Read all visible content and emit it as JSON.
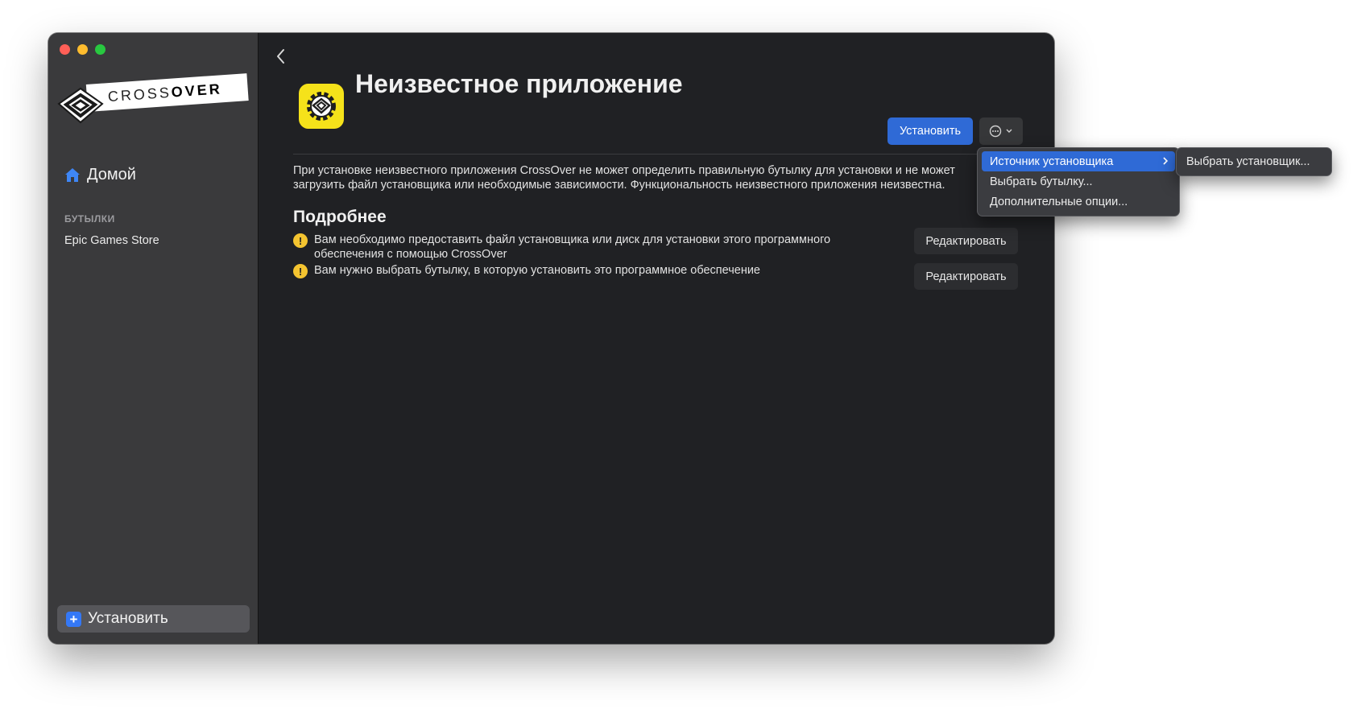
{
  "sidebar": {
    "logo": {
      "text_light": "CROSS",
      "text_bold": "OVER"
    },
    "home_label": "Домой",
    "section_label": "БУТЫЛКИ",
    "bottles": [
      "Epic Games Store"
    ],
    "install_label": "Установить"
  },
  "main": {
    "title": "Неизвестное приложение",
    "install_button": "Установить",
    "description_line1": "При установке неизвестного приложения CrossOver не может определить правильную бутылку для установки и не может",
    "description_line2": "загрузить файл установщика или необходимые зависимости. Функциональность неизвестного приложения неизвестна.",
    "details_heading": "Подробнее",
    "requirements": [
      {
        "text": "Вам необходимо предоставить файл установщика или диск для установки этого программного обеспечения с помощью CrossOver",
        "action": "Редактировать"
      },
      {
        "text": "Вам нужно выбрать бутылку, в которую установить это программное обеспечение",
        "action": "Редактировать"
      }
    ]
  },
  "menu": {
    "items": [
      "Источник установщика",
      "Выбрать бутылку...",
      "Дополнительные опции..."
    ],
    "submenu_item": "Выбрать установщик..."
  },
  "colors": {
    "accent": "#2f6ad6",
    "warning": "#f4c430",
    "app_icon": "#f5e21a",
    "sidebar_bg": "#3a3a3c",
    "main_bg": "#202124"
  }
}
